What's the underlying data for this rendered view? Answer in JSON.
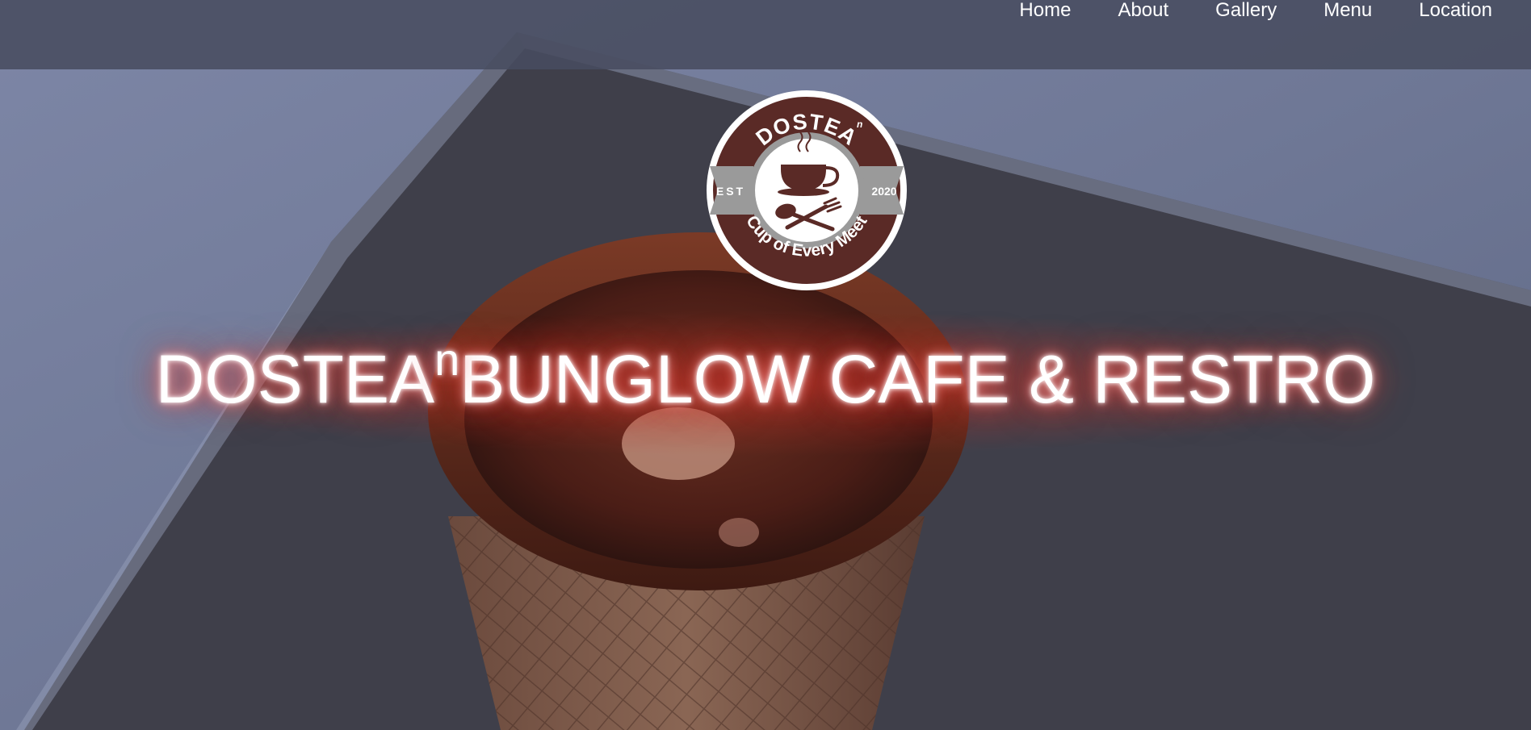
{
  "nav": {
    "items": [
      {
        "label": "Home"
      },
      {
        "label": "About"
      },
      {
        "label": "Gallery"
      },
      {
        "label": "Menu"
      },
      {
        "label": "Location"
      }
    ]
  },
  "logo": {
    "brand": "DOSTEA",
    "brand_sup": "n",
    "est_label": "EST",
    "year": "2020",
    "tagline": "Cup of Every Meet",
    "colors": {
      "ring": "#5a2a26",
      "band": "#9a9a9a"
    }
  },
  "hero": {
    "title_main": "DOSTEA",
    "title_sup": "n",
    "title_rest": "BUNGLOW CAFE & RESTRO"
  },
  "colors": {
    "nav_background": "#484c60",
    "title_glow": "#e0463c"
  }
}
